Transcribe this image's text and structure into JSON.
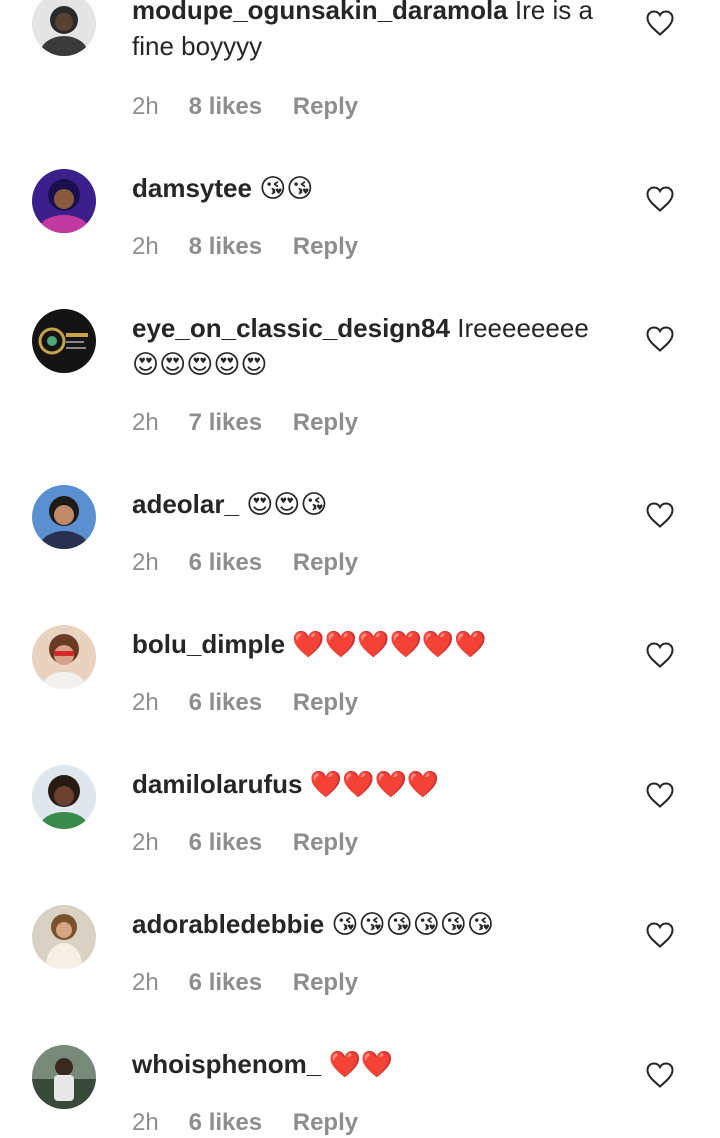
{
  "comments": [
    {
      "user": "modupe_ogunsakin_daramola",
      "text": "Ire is a fine boyyyy",
      "time": "2h",
      "likes": "8 likes",
      "reply": "Reply"
    },
    {
      "user": "damsytee",
      "text": "😘😘",
      "time": "2h",
      "likes": "8 likes",
      "reply": "Reply"
    },
    {
      "user": "eye_on_classic_design84",
      "text": "Ireeeeeeee 😍😍😍😍😍",
      "time": "2h",
      "likes": "7 likes",
      "reply": "Reply"
    },
    {
      "user": "adeolar_",
      "text": "😍😍😘",
      "time": "2h",
      "likes": "6 likes",
      "reply": "Reply"
    },
    {
      "user": "bolu_dimple",
      "text": "❤️❤️❤️❤️❤️❤️",
      "time": "2h",
      "likes": "6 likes",
      "reply": "Reply"
    },
    {
      "user": "damilolarufus",
      "text": "❤️❤️❤️❤️",
      "time": "2h",
      "likes": "6 likes",
      "reply": "Reply"
    },
    {
      "user": "adorabledebbie",
      "text": "😘😘😘😘😘😘",
      "time": "2h",
      "likes": "6 likes",
      "reply": "Reply"
    },
    {
      "user": "whoisphenom_",
      "text": "❤️❤️",
      "time": "2h",
      "likes": "6 likes",
      "reply": "Reply"
    }
  ],
  "colors": {
    "text": "#262626",
    "meta": "#8e8e8e",
    "background": "#ffffff"
  },
  "icons": {
    "like": "heart-outline-icon"
  }
}
